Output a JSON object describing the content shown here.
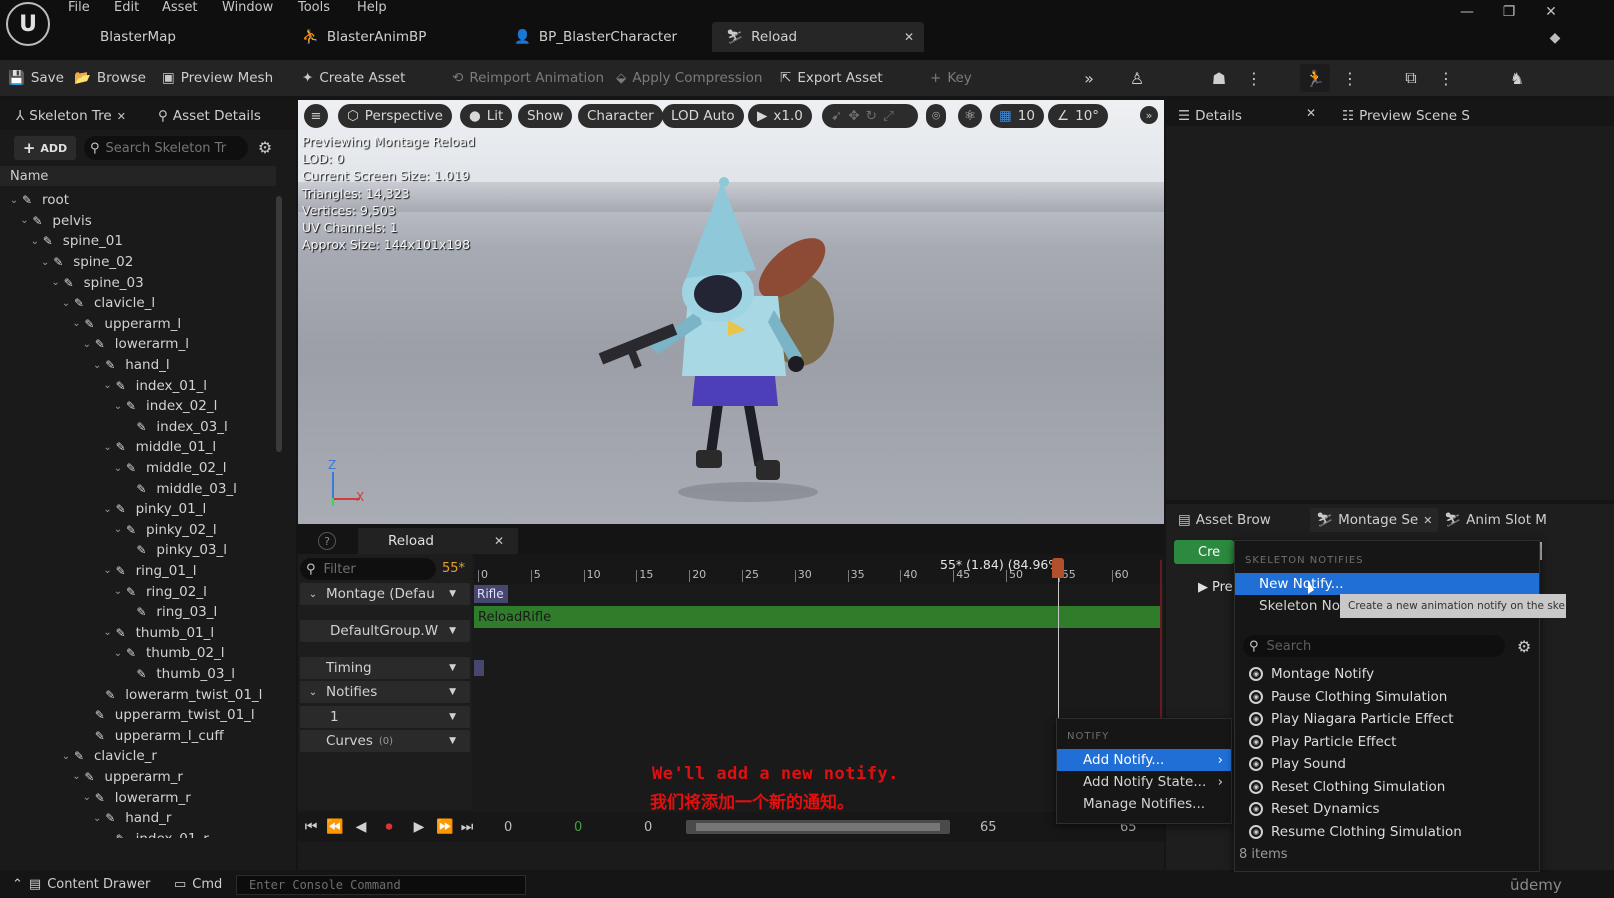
{
  "menu": [
    "File",
    "Edit",
    "Asset",
    "Window",
    "Tools",
    "Help"
  ],
  "doc_tabs": [
    "BlasterMap",
    "BlasterAnimBP",
    "BP_BlasterCharacter",
    "Reload"
  ],
  "toolbar": {
    "save": "Save",
    "browse": "Browse",
    "preview_mesh": "Preview Mesh",
    "create_asset": "Create Asset",
    "reimport": "Reimport Animation",
    "apply_compression": "Apply Compression",
    "export_asset": "Export Asset",
    "key": "Key"
  },
  "left_panel": {
    "tab_skeleton": "Skeleton Tre",
    "tab_asset_details": "Asset Details",
    "add_label": "ADD",
    "search_placeholder": "Search Skeleton Tr",
    "column_name": "Name",
    "bones": [
      {
        "name": "root",
        "depth": 0,
        "open": true
      },
      {
        "name": "pelvis",
        "depth": 1,
        "open": true
      },
      {
        "name": "spine_01",
        "depth": 2,
        "open": true
      },
      {
        "name": "spine_02",
        "depth": 3,
        "open": true
      },
      {
        "name": "spine_03",
        "depth": 4,
        "open": true
      },
      {
        "name": "clavicle_l",
        "depth": 5,
        "open": true
      },
      {
        "name": "upperarm_l",
        "depth": 6,
        "open": true
      },
      {
        "name": "lowerarm_l",
        "depth": 7,
        "open": true
      },
      {
        "name": "hand_l",
        "depth": 8,
        "open": true
      },
      {
        "name": "index_01_l",
        "depth": 9,
        "open": true
      },
      {
        "name": "index_02_l",
        "depth": 10,
        "open": true
      },
      {
        "name": "index_03_l",
        "depth": 11,
        "open": false
      },
      {
        "name": "middle_01_l",
        "depth": 9,
        "open": true
      },
      {
        "name": "middle_02_l",
        "depth": 10,
        "open": true
      },
      {
        "name": "middle_03_l",
        "depth": 11,
        "open": false
      },
      {
        "name": "pinky_01_l",
        "depth": 9,
        "open": true
      },
      {
        "name": "pinky_02_l",
        "depth": 10,
        "open": true
      },
      {
        "name": "pinky_03_l",
        "depth": 11,
        "open": false
      },
      {
        "name": "ring_01_l",
        "depth": 9,
        "open": true
      },
      {
        "name": "ring_02_l",
        "depth": 10,
        "open": true
      },
      {
        "name": "ring_03_l",
        "depth": 11,
        "open": false
      },
      {
        "name": "thumb_01_l",
        "depth": 9,
        "open": true
      },
      {
        "name": "thumb_02_l",
        "depth": 10,
        "open": true
      },
      {
        "name": "thumb_03_l",
        "depth": 11,
        "open": false
      },
      {
        "name": "lowerarm_twist_01_l",
        "depth": 8,
        "open": false
      },
      {
        "name": "upperarm_twist_01_l",
        "depth": 7,
        "open": false
      },
      {
        "name": "upperarm_l_cuff",
        "depth": 7,
        "open": false
      },
      {
        "name": "clavicle_r",
        "depth": 5,
        "open": true
      },
      {
        "name": "upperarm_r",
        "depth": 6,
        "open": true
      },
      {
        "name": "lowerarm_r",
        "depth": 7,
        "open": true
      },
      {
        "name": "hand_r",
        "depth": 8,
        "open": true
      },
      {
        "name": "index_01_r",
        "depth": 9,
        "open": true
      }
    ]
  },
  "viewport": {
    "perspective": "Perspective",
    "lit": "Lit",
    "show": "Show",
    "character": "Character",
    "lod": "LOD Auto",
    "speed": "x1.0",
    "grid": "10",
    "angle": "10°",
    "stats": [
      "Previewing Montage Reload",
      "LOD: 0",
      "Current Screen Size: 1.019",
      "Triangles: 14,323",
      "Vertices: 9,503",
      "UV Channels: 1",
      "Approx Size: 144x101x198"
    ],
    "axis_z": "Z",
    "axis_x": "X"
  },
  "right_panel": {
    "tab_details": "Details",
    "tab_preview_scene": "Preview Scene S",
    "tab_asset_browser": "Asset Brow",
    "tab_montage_sections": "Montage Se",
    "tab_anim_slot": "Anim Slot M",
    "create_label": "Cre",
    "preview_label": "Pre"
  },
  "montage": {
    "tab_title": "Reload",
    "filter_placeholder": "Filter",
    "frame_count": "55*",
    "tracks": {
      "montage": "Montage (Defau",
      "group": "DefaultGroup.W",
      "timing": "Timing",
      "notifies": "Notifies",
      "notify_row": "1",
      "curves": "Curves",
      "curves_count": "(0)"
    },
    "slot_label": "Rifle",
    "segment_label": "ReloadRifle",
    "ruler_ticks": [
      "0",
      "5",
      "10",
      "15",
      "20",
      "25",
      "30",
      "35",
      "40",
      "45",
      "50",
      "55",
      "60"
    ],
    "playhead_readout": "55* (1.84) (84.96%)",
    "transport": {
      "start": "0",
      "mid_green": "0",
      "range_start": "0",
      "range_end": "65",
      "end": "65"
    }
  },
  "context_menu": {
    "header": "NOTIFY",
    "items": [
      "Add Notify...",
      "Add Notify State...",
      "Manage Notifies..."
    ]
  },
  "submenu": {
    "header": "SKELETON NOTIFIES",
    "new_notify": "New Notify...",
    "skeleton_notify": "Skeleton Notif",
    "tooltip": "Create a new animation notify on the skeleton",
    "search_placeholder": "Search",
    "items": [
      "Montage Notify",
      "Pause Clothing Simulation",
      "Play Niagara Particle Effect",
      "Play Particle Effect",
      "Play Sound",
      "Reset Clothing Simulation",
      "Reset Dynamics",
      "Resume Clothing Simulation"
    ],
    "count": "8 items"
  },
  "statusbar": {
    "content_drawer": "Content Drawer",
    "cmd": "Cmd",
    "console_placeholder": "Enter Console Command"
  },
  "subtitles": {
    "en": "We'll add a new notify.",
    "zh": "我们将添加一个新的通知。"
  },
  "watermark": "ūdemy",
  "colors": {
    "accent_blue": "#1f6fd6",
    "segment_green": "#2f7d2b",
    "playhead": "#b2502e",
    "subtitle_red": "#e01010"
  }
}
